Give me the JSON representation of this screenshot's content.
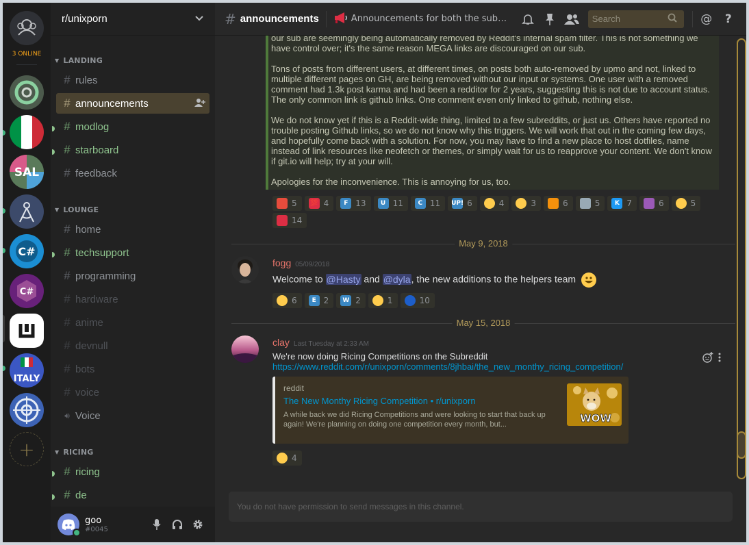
{
  "rail": {
    "online_label": "3 ONLINE",
    "add_label": "+"
  },
  "guild": {
    "name": "r/unixporn"
  },
  "categories": {
    "landing": "LANDING",
    "lounge": "LOUNGE",
    "ricing": "RICING"
  },
  "channels": {
    "rules": "rules",
    "announcements": "announcements",
    "modlog": "modlog",
    "starboard": "starboard",
    "feedback": "feedback",
    "home": "home",
    "techsupport": "techsupport",
    "programming": "programming",
    "hardware": "hardware",
    "anime": "anime",
    "devnull": "devnull",
    "bots": "bots",
    "voice_text": "voice",
    "voice_channel": "Voice",
    "ricing": "ricing",
    "de": "de"
  },
  "user": {
    "name": "goo",
    "tag": "#0045"
  },
  "topbar": {
    "channel": "announcements",
    "topic": "Announcements for both the subreddit and server",
    "search_placeholder": "Search"
  },
  "quote": {
    "p1": "our sub are seemingly being automatically removed by Reddit's internal spam filter. This is not something we have control over; it's the same reason MEGA links are discouraged on our sub.",
    "p2": "Tons of posts from different users, at different times, on posts both auto-removed by upmo and not, linked to multiple different pages on GH, are being removed without our input or systems. One user with a removed comment had 1.3k post karma and had been a redditor for 2 years, suggesting this is not due to account status. The only common link is github links. One comment even only linked to github, nothing else.",
    "p3": "We do not know yet if this is a Reddit-wide thing, limited to a few subreddits, or just us. Others have reported no trouble posting Github links, so we do not know why this triggers. We will work that out in the coming few days, and hopefully come back with a solution. For now, you may have to find a new place to host dotfiles, name instead of link resources like neofetch or themes, or simply wait for us to reapprove your content. We don't know if git.io will help; try at your will.",
    "p4": "Apologies for the inconvenience. This is annoying for us, too."
  },
  "reactions1": [
    {
      "icon": "rainbow-flag",
      "count": "5",
      "color": "#e74c3c",
      "glyph": ""
    },
    {
      "icon": "hundred",
      "count": "4",
      "color": "#dd2e44",
      "glyph": "💯"
    },
    {
      "icon": "letter-f",
      "count": "13",
      "color": "#3b88c3",
      "glyph": "F"
    },
    {
      "icon": "letter-u",
      "count": "11",
      "color": "#3b88c3",
      "glyph": "U"
    },
    {
      "icon": "letter-c",
      "count": "11",
      "color": "#3b88c3",
      "glyph": "C"
    },
    {
      "icon": "up-button",
      "count": "6",
      "color": "#3b88c3",
      "glyph": "UP!"
    },
    {
      "icon": "disappointed-face",
      "count": "4",
      "color": "#ffcc4d",
      "glyph": ""
    },
    {
      "icon": "sunglasses-face",
      "count": "3",
      "color": "#ffcc4d",
      "glyph": ""
    },
    {
      "icon": "taco",
      "count": "6",
      "color": "#f4900c",
      "glyph": ""
    },
    {
      "icon": "moai",
      "count": "5",
      "color": "#99aab5",
      "glyph": ""
    },
    {
      "icon": "kde-logo",
      "count": "7",
      "color": "#1d99f3",
      "glyph": "K"
    },
    {
      "icon": "landscape",
      "count": "6",
      "color": "#9b59b6",
      "glyph": ""
    },
    {
      "icon": "thinking-face",
      "count": "5",
      "color": "#ffcc4d",
      "glyph": ""
    },
    {
      "icon": "lipstick",
      "count": "14",
      "color": "#dd2e44",
      "glyph": ""
    }
  ],
  "date1": "May 9, 2018",
  "fogg": {
    "author": "fogg",
    "timestamp": "05/09/2018",
    "text_pre": "Welcome to ",
    "mention1": "@Hasty",
    "text_mid": " and ",
    "mention2": "@dyla",
    "text_post": ", the new additions to the helpers team",
    "emoji": "😃"
  },
  "reactions2": [
    {
      "icon": "smiley-face",
      "count": "6",
      "color": "#ffcc4d",
      "glyph": ""
    },
    {
      "icon": "letter-e",
      "count": "2",
      "color": "#3b88c3",
      "glyph": "E"
    },
    {
      "icon": "letter-w",
      "count": "2",
      "color": "#3b88c3",
      "glyph": "W"
    },
    {
      "icon": "cowboy-face",
      "count": "1",
      "color": "#ffcc4d",
      "glyph": ""
    },
    {
      "icon": "blue-ball",
      "count": "10",
      "color": "#1d5ec9",
      "glyph": ""
    }
  ],
  "date2": "May 15, 2018",
  "clay": {
    "author": "clay",
    "timestamp": "Last Tuesday at 2:33 AM",
    "text": "We're now doing Ricing Competitions on the Subreddit",
    "link": "https://www.reddit.com/r/unixporn/comments/8jhbai/the_new_monthy_ricing_competition/"
  },
  "embed": {
    "provider": "reddit",
    "title": "The New Monthy Ricing Competition • r/unixporn",
    "description": "A while back we did Ricing Competitions and were looking to start that back up again! We're planning on doing one competition every month, but...",
    "thumb_text": "WOW"
  },
  "reactions3": [
    {
      "icon": "thumbs-up",
      "count": "4",
      "color": "#ffcc4d",
      "glyph": ""
    }
  ],
  "input": {
    "placeholder": "You do not have permission to send messages in this channel."
  }
}
